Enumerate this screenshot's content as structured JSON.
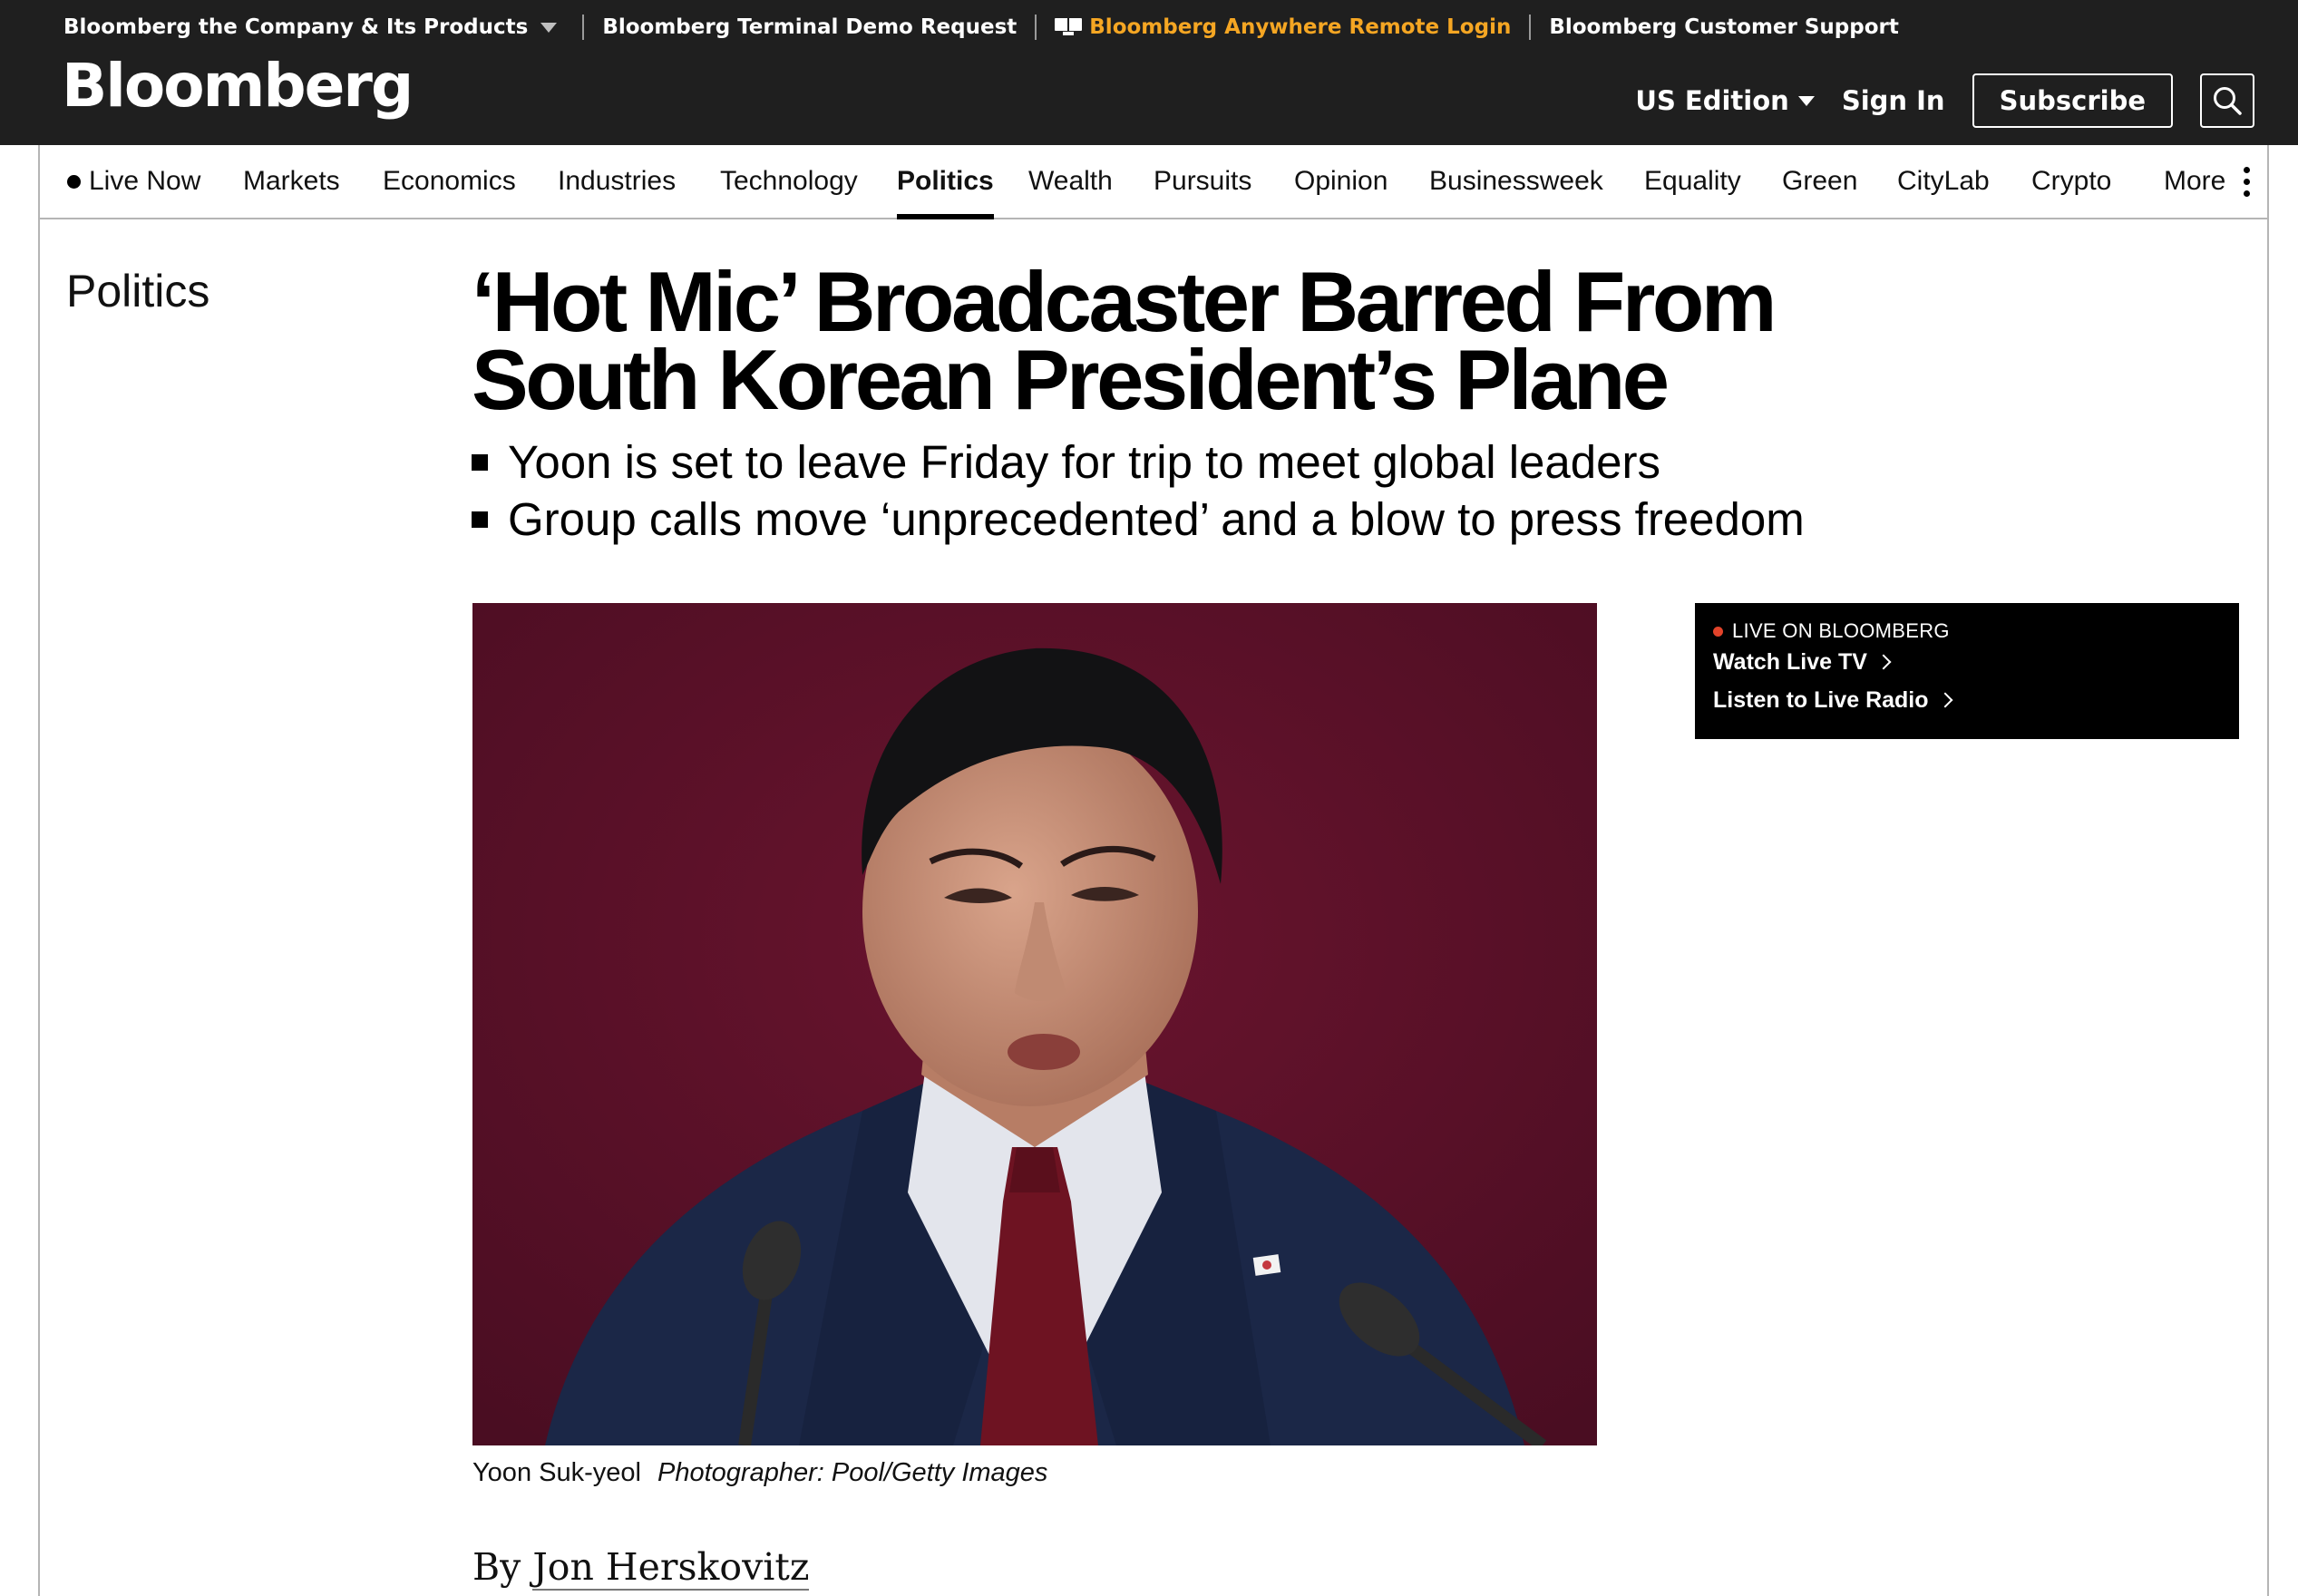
{
  "header": {
    "utility_links": [
      {
        "label": "Bloomberg the Company & Its Products",
        "has_dropdown": true
      },
      {
        "label": "Bloomberg Terminal Demo Request"
      },
      {
        "label": "Bloomberg Anywhere Remote Login",
        "accent": "#f5a623"
      },
      {
        "label": "Bloomberg Customer Support"
      }
    ],
    "logo": "Bloomberg",
    "edition": "US Edition",
    "sign_in": "Sign In",
    "subscribe": "Subscribe",
    "search_icon": "search-icon"
  },
  "nav": {
    "items": [
      {
        "label": "Live Now",
        "icon": "live-dot-icon"
      },
      {
        "label": "Markets"
      },
      {
        "label": "Economics"
      },
      {
        "label": "Industries"
      },
      {
        "label": "Technology"
      },
      {
        "label": "Politics",
        "active": true
      },
      {
        "label": "Wealth"
      },
      {
        "label": "Pursuits"
      },
      {
        "label": "Opinion"
      },
      {
        "label": "Businessweek"
      },
      {
        "label": "Equality"
      },
      {
        "label": "Green"
      },
      {
        "label": "CityLab"
      },
      {
        "label": "Crypto"
      },
      {
        "label": "More",
        "icon": "kebab-menu-icon"
      }
    ]
  },
  "article": {
    "section": "Politics",
    "headline": "‘Hot Mic’ Broadcaster Barred From South Korean President’s Plane",
    "bullets": [
      "Yoon is set to leave Friday for trip to meet global leaders",
      "Group calls move ‘unprecedented’ and a blow to press freedom"
    ],
    "photo_caption": "Yoon Suk-yeol",
    "photo_credit": "Photographer: Pool/Getty Images",
    "byline_prefix": "By",
    "author": "Jon Herskovitz"
  },
  "live": {
    "label": "LIVE ON BLOOMBERG",
    "watch": "Watch Live TV",
    "listen": "Listen to Live Radio",
    "dot_color": "#e2432a"
  }
}
